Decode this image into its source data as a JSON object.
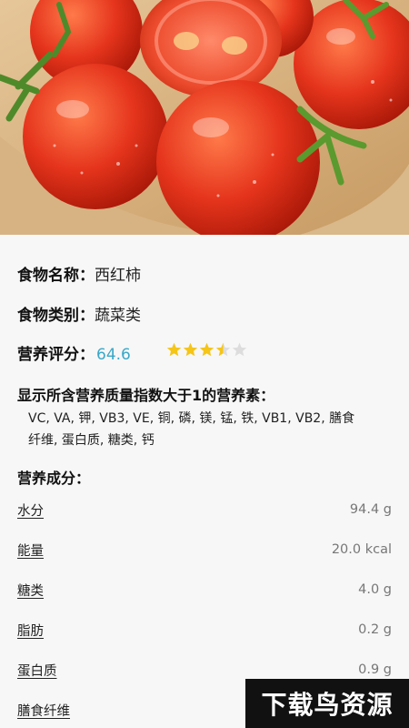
{
  "food": {
    "name_label": "食物名称：",
    "name_value": "西红柿",
    "category_label": "食物类别：",
    "category_value": "蔬菜类",
    "score_label": "营养评分：",
    "score_value": "64.6",
    "rating_stars": 3.5,
    "rating_max": 5
  },
  "nutrient_summary": {
    "title": "显示所含营养质量指数大于1的营养素：",
    "line1": "VC, VA, 钾, VB3, VE, 铜, 磷, 镁, 锰, 铁, VB1, VB2, 膳食",
    "line2": "纤维, 蛋白质, 糖类, 钙"
  },
  "composition": {
    "title": "营养成分：",
    "items": [
      {
        "name": "水分",
        "value": "94.4 g"
      },
      {
        "name": "能量",
        "value": "20.0 kcal"
      },
      {
        "name": "糖类",
        "value": "4.0 g"
      },
      {
        "name": "脂肪",
        "value": "0.2 g"
      },
      {
        "name": "蛋白质",
        "value": "0.9 g"
      },
      {
        "name": "膳食纤维",
        "value": ""
      }
    ]
  },
  "colors": {
    "score": "#3aa7c8",
    "star_filled": "#f5c518",
    "star_empty": "#dddddd",
    "tomato": "#e5341c"
  },
  "watermark": "下载鸟资源"
}
